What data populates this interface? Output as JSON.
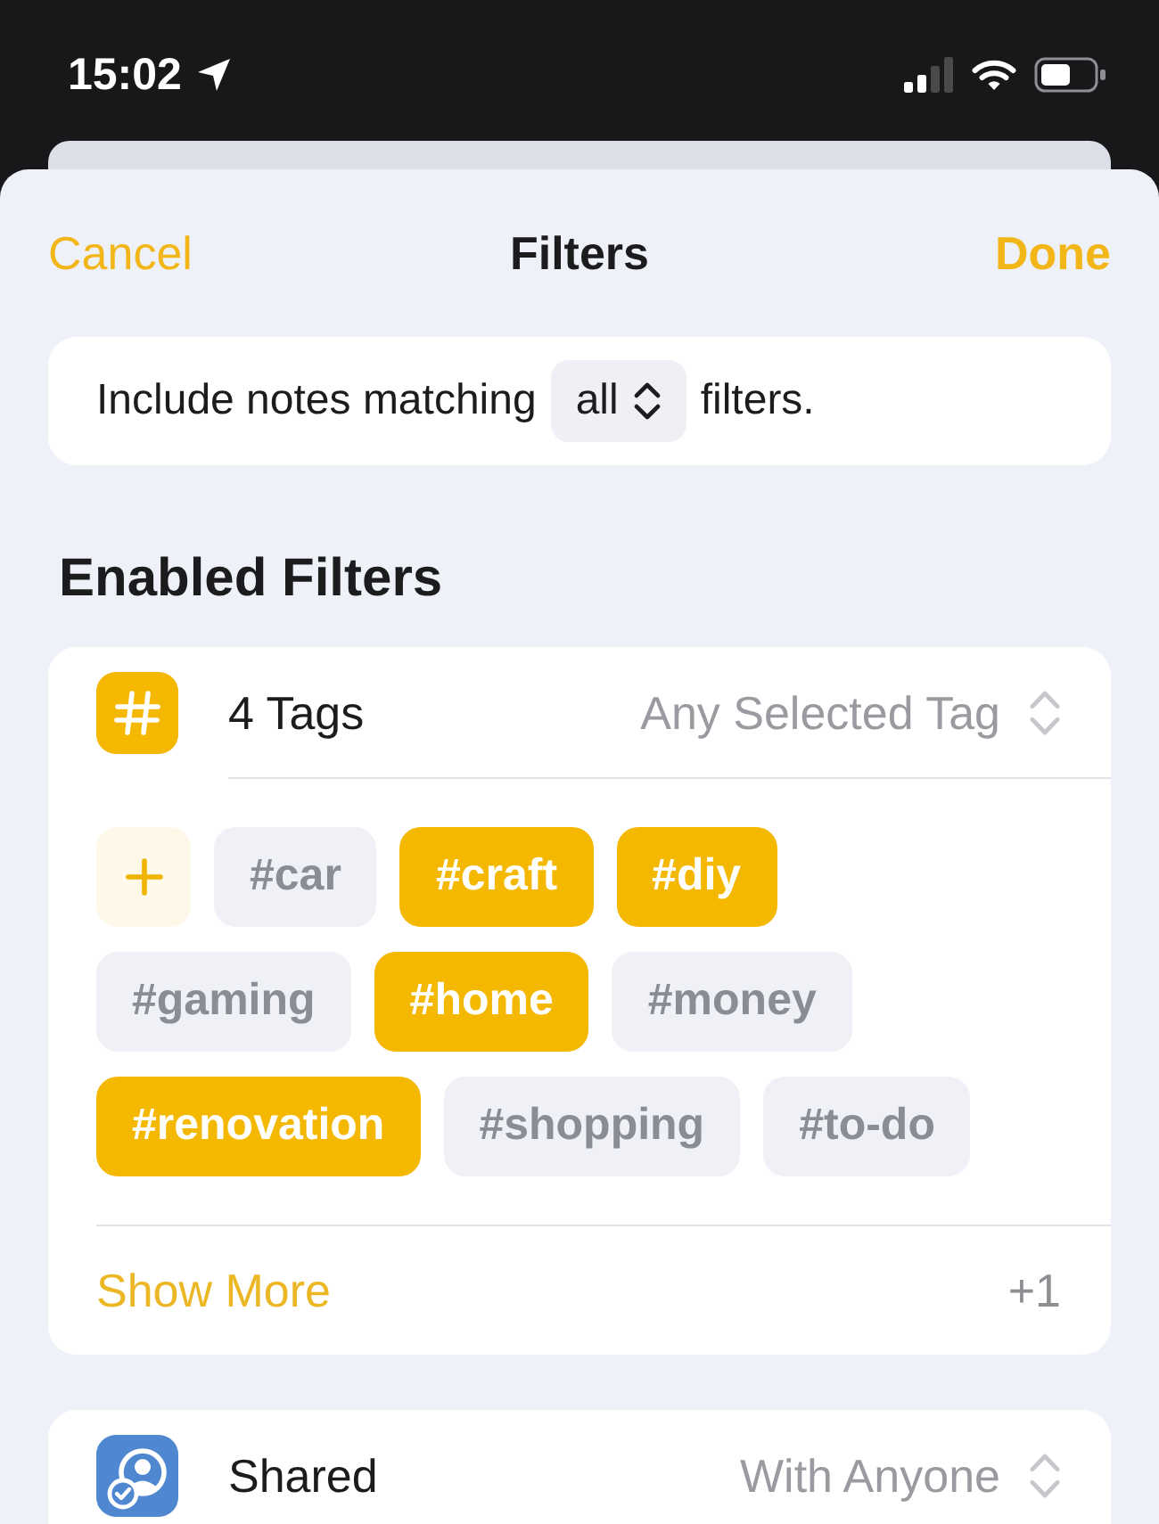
{
  "status_bar": {
    "time": "15:02"
  },
  "nav": {
    "cancel": "Cancel",
    "title": "Filters",
    "done": "Done"
  },
  "match": {
    "prefix": "Include notes matching",
    "mode": "all",
    "suffix": "filters."
  },
  "section_title": "Enabled Filters",
  "filters": [
    {
      "kind": "tags",
      "label": "4 Tags",
      "value": "Any Selected Tag",
      "tags": [
        {
          "label": "#car",
          "selected": false
        },
        {
          "label": "#craft",
          "selected": true
        },
        {
          "label": "#diy",
          "selected": true
        },
        {
          "label": "#gaming",
          "selected": false
        },
        {
          "label": "#home",
          "selected": true
        },
        {
          "label": "#money",
          "selected": false
        },
        {
          "label": "#renovation",
          "selected": true
        },
        {
          "label": "#shopping",
          "selected": false
        },
        {
          "label": "#to-do",
          "selected": false
        }
      ],
      "show_more": "Show More",
      "more_count": "+1"
    },
    {
      "kind": "shared",
      "label": "Shared",
      "value": "With Anyone"
    }
  ]
}
